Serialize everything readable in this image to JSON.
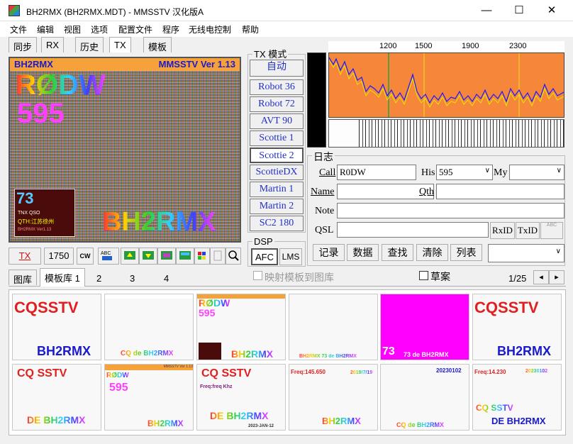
{
  "window": {
    "title": "BH2RMX (BH2RMX.MDT) - MMSSTV 汉化版A",
    "min": "—",
    "max": "☐",
    "close": "✕"
  },
  "menu": [
    "文件",
    "编辑",
    "视图",
    "选项",
    "配置文件",
    "程序",
    "无线电控制",
    "帮助"
  ],
  "tabs": [
    "同步",
    "RX",
    "历史",
    "TX",
    "模板"
  ],
  "image": {
    "callsign": "BH2RMX",
    "version": "MMSSTV Ver 1.13",
    "big_call": "RØDW",
    "rst": "595",
    "footer": "BH2RMX",
    "qsl": {
      "num": "73",
      "line1": "TNX QSO",
      "line2": "QTH:江苏徐州",
      "line3": "BH2RMX Ver1.13"
    }
  },
  "tx_mode": {
    "header": "TX 模式",
    "auto": "自动",
    "modes": [
      "Robot 36",
      "Robot 72",
      "AVT 90",
      "Scottie 1",
      "Scottie 2",
      "ScottieDX",
      "Martin 1",
      "Martin 2",
      "SC2 180"
    ]
  },
  "dsp": {
    "header": "DSP",
    "afc": "AFC",
    "lms": "LMS"
  },
  "spectrum": {
    "ticks": [
      "1200",
      "1500",
      "1900",
      "2300"
    ]
  },
  "toolbar": {
    "tx": "TX",
    "freq": "1750",
    "cw": "CW"
  },
  "log": {
    "header": "日志",
    "call_label": "Call",
    "call_value": "R0DW",
    "his_label": "His",
    "his_value": "595",
    "my_label": "My",
    "my_value": "",
    "name_label": "Name",
    "name_value": "",
    "qth_label": "Qth",
    "qth_value": "",
    "note_label": "Note",
    "note_value": "",
    "qsl_label": "QSL",
    "qsl_value": "",
    "rxid": "RxID",
    "txid": "TxID",
    "abc": "ABC",
    "buttons": [
      "记录",
      "数据",
      "查找",
      "清除",
      "列表"
    ],
    "dropdown": ""
  },
  "library": {
    "tabs": [
      "图库",
      "模板库 1",
      "2",
      "3",
      "4"
    ],
    "map_label": "映射模板到图库",
    "draft_label": "草案",
    "page": "1/25",
    "prev": "◂",
    "next": "▸"
  },
  "templates": [
    {
      "lines": [
        "CQSSTV",
        "BH2RMX"
      ]
    },
    {
      "lines": [
        "",
        "CQ de BH2RMX"
      ]
    },
    {
      "lines": [
        "RØDW",
        "595",
        "BH2RMX"
      ]
    },
    {
      "lines": [
        "",
        "BH2RMX 73 de BH2RMX"
      ]
    },
    {
      "lines": [
        "73",
        "73 de BH2RMX"
      ]
    },
    {
      "lines": [
        "CQSSTV",
        "BH2RMX"
      ]
    },
    {
      "lines": [
        "CQ SSTV",
        "DE BH2RMX"
      ]
    },
    {
      "lines": [
        "RØDW",
        "595",
        "BH2RMX",
        "MMSSTV Ver 1.13"
      ]
    },
    {
      "lines": [
        "CQ SSTV",
        "Freq:freq Khz",
        "DE BH2RMX",
        "2023-JAN-12"
      ]
    },
    {
      "lines": [
        "Freq:145.650",
        "2019/7/19",
        "BH2RMX"
      ]
    },
    {
      "lines": [
        "20230102",
        "CQ de BH2RMX"
      ]
    },
    {
      "lines": [
        "Freq:14.230",
        "20230102",
        "CQ SSTV",
        "DE BH2RMX"
      ]
    }
  ]
}
